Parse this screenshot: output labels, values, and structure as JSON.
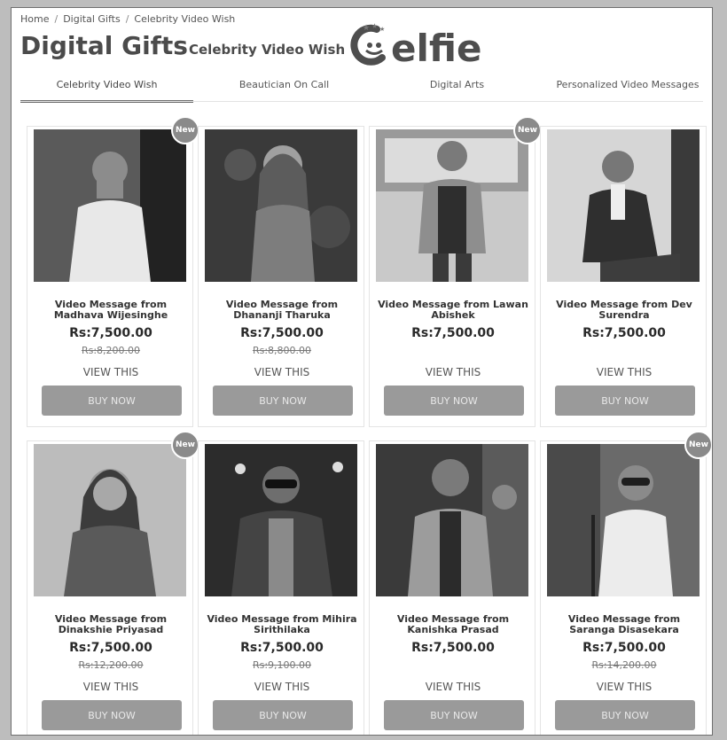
{
  "breadcrumb": {
    "home": "Home",
    "level1": "Digital Gifts",
    "level2": "Celebrity Video Wish",
    "separator": "/"
  },
  "header": {
    "title": "Digital Gifts",
    "subtitle": "Celebrity Video Wish",
    "logo_text": "elfie"
  },
  "tabs": [
    {
      "label": "Celebrity Video Wish",
      "active": true
    },
    {
      "label": "Beautician On Call",
      "active": false
    },
    {
      "label": "Digital Arts",
      "active": false
    },
    {
      "label": "Personalized Video Messages",
      "active": false
    }
  ],
  "products": [
    {
      "name": "Video Message from Madhava Wijesinghe",
      "price": "Rs:7,500.00",
      "old_price": "Rs:8,200.00",
      "badge": "New",
      "view_label": "VIEW THIS",
      "buy_label": "BUY NOW"
    },
    {
      "name": "Video Message from Dhananji Tharuka",
      "price": "Rs:7,500.00",
      "old_price": "Rs:8,800.00",
      "badge": "",
      "view_label": "VIEW THIS",
      "buy_label": "BUY NOW"
    },
    {
      "name": "Video Message from Lawan Abishek",
      "price": "Rs:7,500.00",
      "old_price": "",
      "badge": "New",
      "view_label": "VIEW THIS",
      "buy_label": "BUY NOW"
    },
    {
      "name": "Video Message from Dev Surendra",
      "price": "Rs:7,500.00",
      "old_price": "",
      "badge": "",
      "view_label": "VIEW THIS",
      "buy_label": "BUY NOW"
    },
    {
      "name": "Video Message from Dinakshie Priyasad",
      "price": "Rs:7,500.00",
      "old_price": "Rs:12,200.00",
      "badge": "New",
      "view_label": "VIEW THIS",
      "buy_label": "BUY NOW"
    },
    {
      "name": "Video Message from Mihira Sirithilaka",
      "price": "Rs:7,500.00",
      "old_price": "Rs:9,100.00",
      "badge": "",
      "view_label": "VIEW THIS",
      "buy_label": "BUY NOW"
    },
    {
      "name": "Video Message from Kanishka Prasad",
      "price": "Rs:7,500.00",
      "old_price": "",
      "badge": "",
      "view_label": "VIEW THIS",
      "buy_label": "BUY NOW"
    },
    {
      "name": "Video Message from Saranga Disasekara",
      "price": "Rs:7,500.00",
      "old_price": "Rs:14,200.00",
      "badge": "New",
      "view_label": "VIEW THIS",
      "buy_label": "BUY NOW"
    }
  ],
  "colors": {
    "button": "#9a9a9a",
    "badge": "#8a8a8a",
    "text": "#333333"
  }
}
